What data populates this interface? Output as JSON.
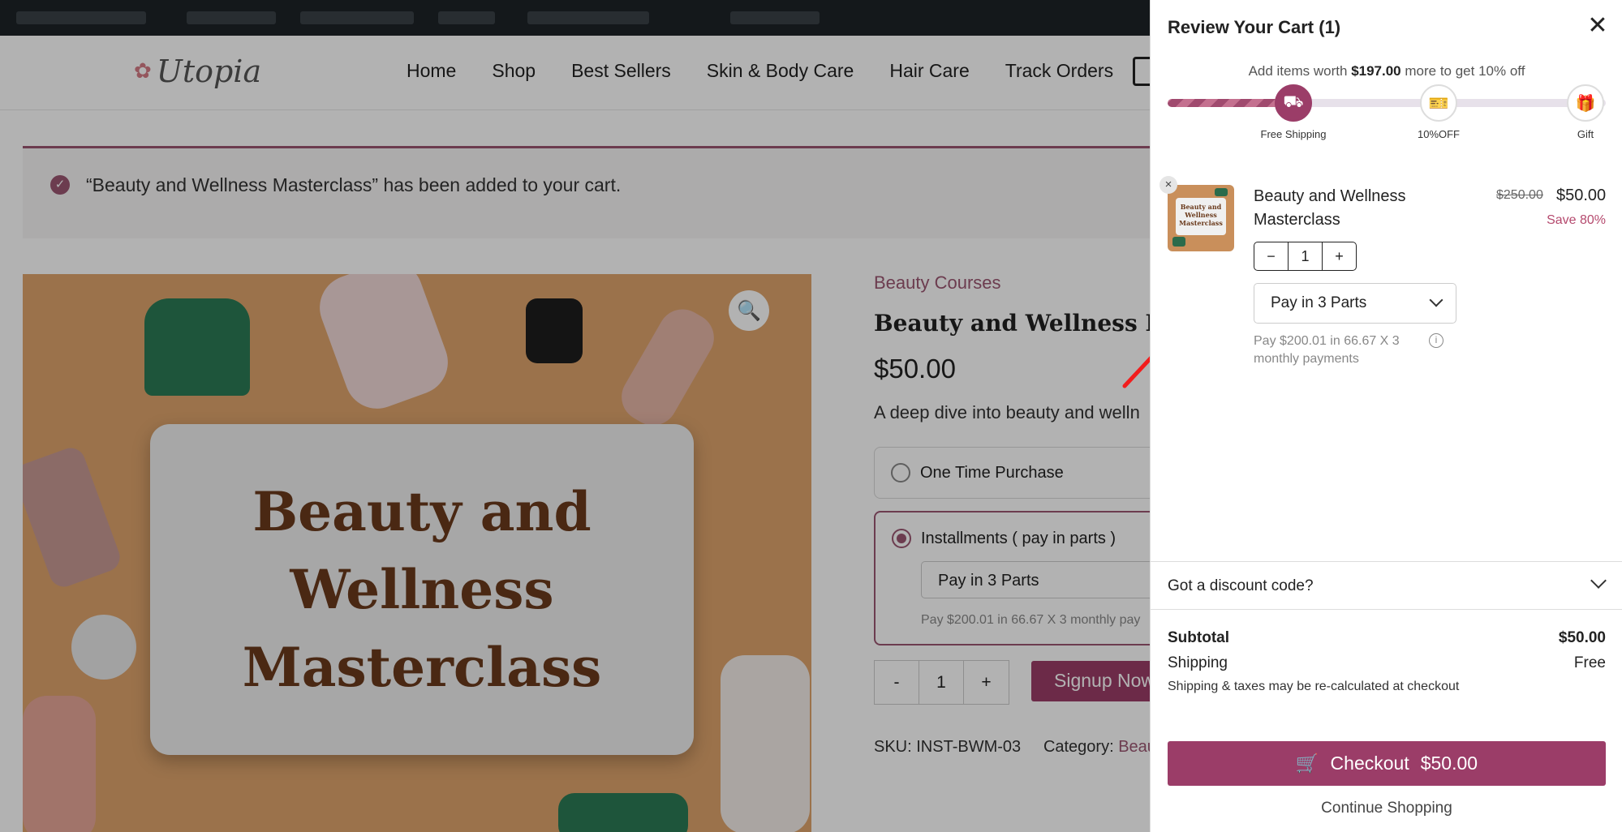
{
  "header": {
    "logo_text": "Utopia",
    "nav": [
      "Home",
      "Shop",
      "Best Sellers",
      "Skin & Body Care",
      "Hair Care",
      "Track Orders"
    ]
  },
  "notice": {
    "message": "“Beauty and Wellness Masterclass” has been added to your cart."
  },
  "product": {
    "image_text": "Beauty and Wellness Masterclass",
    "category": "Beauty Courses",
    "title": "Beauty and Wellness Maste",
    "price": "$50.00",
    "description": "A deep dive into beauty and welln",
    "option_one_time": "One Time Purchase",
    "option_installments": "Installments ( pay in parts )",
    "installment_select": "Pay in 3 Parts",
    "installment_note": "Pay $200.01 in 66.67 X 3 monthly pay",
    "qty_minus": "-",
    "qty_value": "1",
    "qty_plus": "+",
    "signup_button": "Signup Now",
    "sku_label": "SKU: INST-BWM-03",
    "category_label": "Category:",
    "category_link": "Beau"
  },
  "cart": {
    "title": "Review Your Cart (1)",
    "progress_prefix": "Add items worth",
    "progress_amount": "$197.00",
    "progress_suffix": "more to get 10% off",
    "progress_fraction": 0.28,
    "milestones": [
      {
        "label": "Free Shipping",
        "icon": "truck-icon"
      },
      {
        "label": "10%OFF",
        "icon": "ticket-icon"
      },
      {
        "label": "Gift",
        "icon": "gift-icon"
      }
    ],
    "item": {
      "thumb_text": "Beauty and Wellness Masterclass",
      "name": "Beauty and Wellness Masterclass",
      "old_price": "$250.00",
      "price": "$50.00",
      "save": "Save 80%",
      "qty": "1",
      "plan": "Pay in 3 Parts",
      "plan_note": "Pay $200.01 in 66.67 X 3 monthly payments"
    },
    "discount_label": "Got a discount code?",
    "subtotal_label": "Subtotal",
    "subtotal_value": "$50.00",
    "shipping_label": "Shipping",
    "shipping_value": "Free",
    "tax_note": "Shipping & taxes may be re-calculated at checkout",
    "checkout_label": "Checkout",
    "checkout_amount": "$50.00",
    "continue_label": "Continue Shopping"
  },
  "colors": {
    "accent": "#9b3d68",
    "overlay": "rgba(0,0,0,0.30)"
  }
}
